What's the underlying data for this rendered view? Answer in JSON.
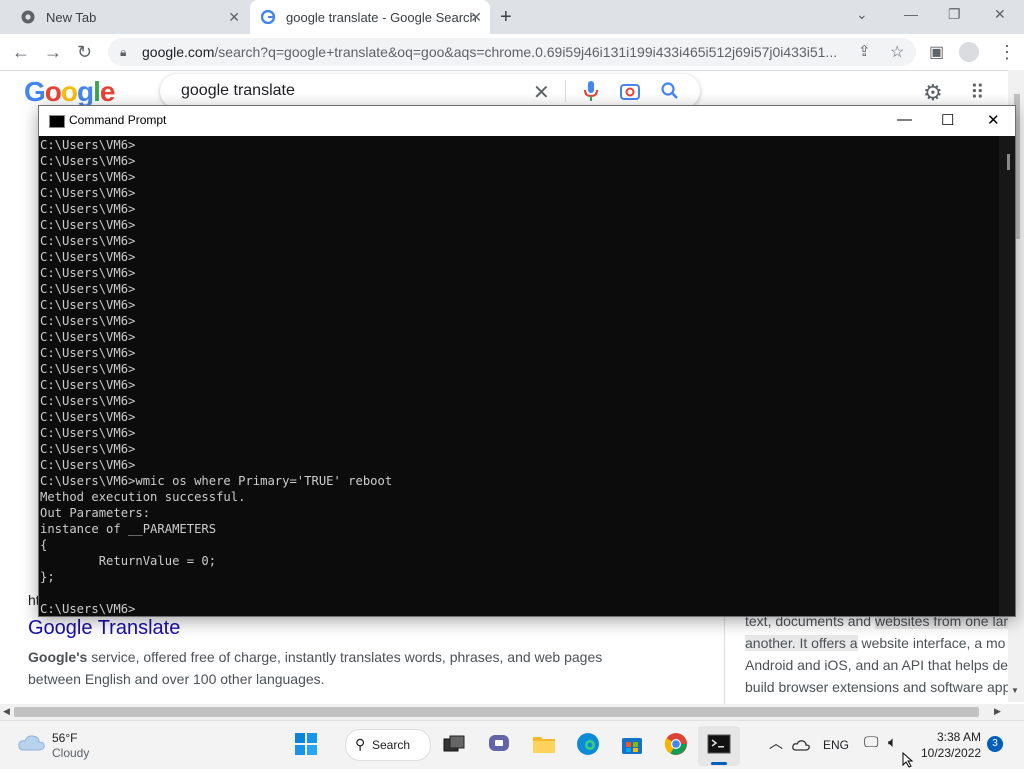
{
  "browser": {
    "tabs": [
      {
        "label": "New Tab"
      },
      {
        "label": "google translate - Google Search"
      }
    ],
    "url_host": "google.com",
    "url_rest": "/search?q=google+translate&oq=goo&aqs=chrome.0.69i59j46i131i199i433i465i512j69i57j0i433i51..."
  },
  "google": {
    "logo_letters": [
      "G",
      "o",
      "o",
      "g",
      "l",
      "e"
    ],
    "logo_colors": [
      "#4285f4",
      "#ea4335",
      "#fbbc05",
      "#4285f4",
      "#34a853",
      "#ea4335"
    ],
    "query": "google translate",
    "partial_url": "ht",
    "result_title": "Google Translate",
    "snippet_bold": "Google's",
    "snippet_rest": " service, offered free of charge, instantly translates words, phrases, and web pages between English and over 100 other languages.",
    "panel_lines": [
      {
        "pre": "text, documents and ",
        "hl": "websites from one lar",
        "post": ""
      },
      {
        "pre": "",
        "hl": "another. It offers a",
        "post": " website interface, a mo"
      },
      {
        "pre": "Android and iOS, and an API that helps de",
        "hl": "",
        "post": ""
      },
      {
        "pre": "build browser extensions and software app",
        "hl": "",
        "post": ""
      }
    ]
  },
  "cmd": {
    "title": "Command Prompt",
    "lines": [
      "C:\\Users\\VM6>",
      "C:\\Users\\VM6>",
      "C:\\Users\\VM6>",
      "C:\\Users\\VM6>",
      "C:\\Users\\VM6>",
      "C:\\Users\\VM6>",
      "C:\\Users\\VM6>",
      "C:\\Users\\VM6>",
      "C:\\Users\\VM6>",
      "C:\\Users\\VM6>",
      "C:\\Users\\VM6>",
      "C:\\Users\\VM6>",
      "C:\\Users\\VM6>",
      "C:\\Users\\VM6>",
      "C:\\Users\\VM6>",
      "C:\\Users\\VM6>",
      "C:\\Users\\VM6>",
      "C:\\Users\\VM6>",
      "C:\\Users\\VM6>",
      "C:\\Users\\VM6>",
      "C:\\Users\\VM6>",
      "C:\\Users\\VM6>wmic os where Primary='TRUE' reboot",
      "Method execution successful.",
      "Out Parameters:",
      "instance of __PARAMETERS",
      "{",
      "        ReturnValue = 0;",
      "};",
      "",
      "C:\\Users\\VM6>"
    ]
  },
  "taskbar": {
    "temp": "56°F",
    "condition": "Cloudy",
    "search_label": "Search",
    "lang": "ENG",
    "time": "3:38 AM",
    "date": "10/23/2022",
    "notif_count": "3"
  },
  "colors": {
    "accent": "#1a73e8",
    "link": "#1a0dab"
  }
}
